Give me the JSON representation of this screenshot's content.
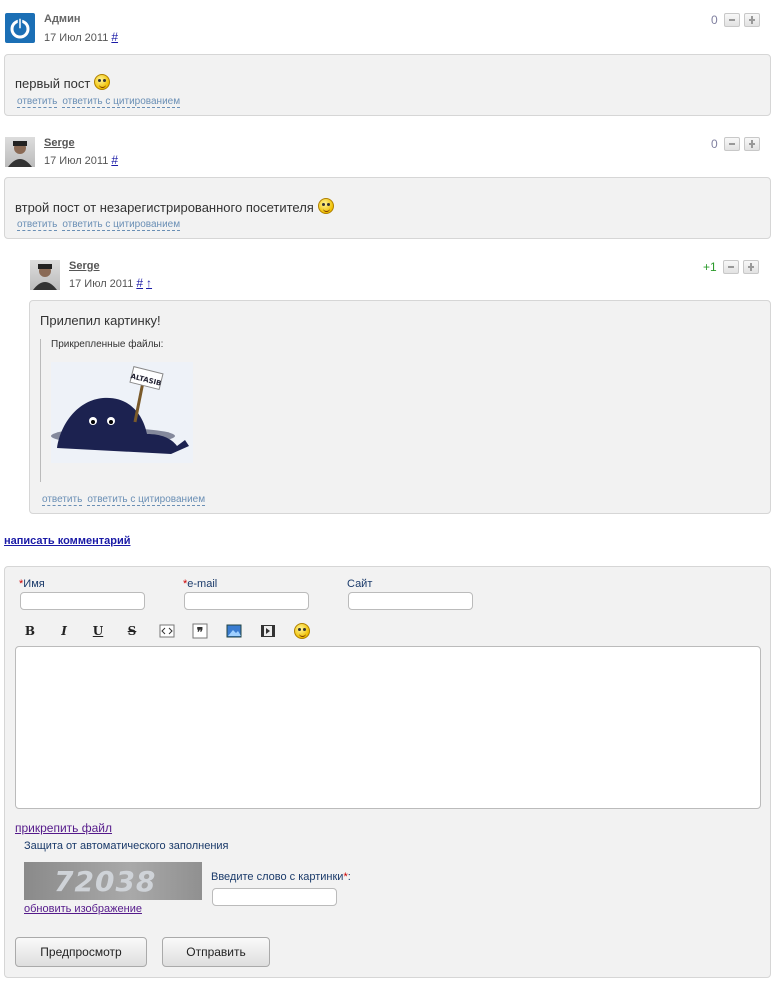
{
  "comments": [
    {
      "author": "Админ",
      "date": "17 Июл 2011",
      "hash": "#",
      "score": "0",
      "text": "первый пост",
      "reply": "ответить",
      "quote": "ответить с цитированием"
    },
    {
      "author": "Serge",
      "date": "17 Июл 2011",
      "hash": "#",
      "score": "0",
      "text": "втрой пост от незарегистрированного посетителя",
      "reply": "ответить",
      "quote": "ответить с цитированием"
    },
    {
      "author": "Serge",
      "date": "17 Июл 2011",
      "hash": "#",
      "up": "↑",
      "score": "+1",
      "text": "Прилепил картинку!",
      "attachments_label": "Прикрепленные файлы:",
      "sign_text": "ALTASIB",
      "reply": "ответить",
      "quote": "ответить с цитированием"
    }
  ],
  "write_comment": "написать комментарий",
  "form": {
    "name_req": "*",
    "name_label": "Имя",
    "email_req": "*",
    "email_label": "e-mail",
    "site_label": "Сайт",
    "toolbar": {
      "bold": "B",
      "italic": "I",
      "underline": "U",
      "strike": "S",
      "quote": "❞"
    },
    "attach_file": "прикрепить файл",
    "captcha_title": "Защита от автоматического заполнения",
    "captcha_code": "72038",
    "captcha_prompt": "Введите слово с картинки",
    "captcha_req": "*",
    "captcha_colon": ":",
    "refresh": "обновить изображение",
    "preview": "Предпросмотр",
    "submit": "Отправить"
  }
}
